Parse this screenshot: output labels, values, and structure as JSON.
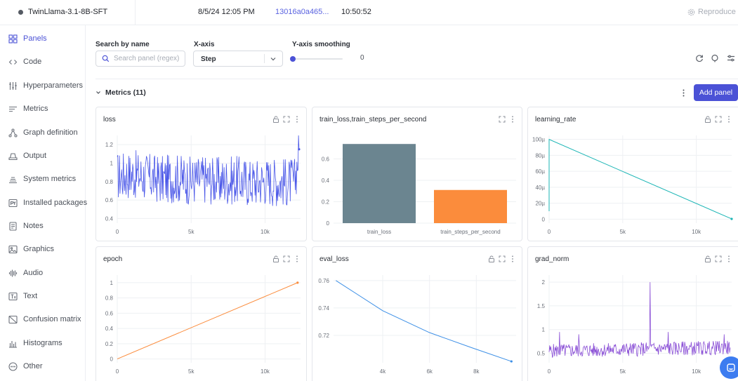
{
  "topbar": {
    "run_name": "TwinLlama-3.1-8B-SFT",
    "date": "8/5/24 12:05 PM",
    "commit": "13016a0a465...",
    "duration": "10:50:52",
    "reproduce": "Reproduce"
  },
  "sidebar": {
    "items": [
      {
        "label": "Panels",
        "icon": "panels-grid-icon"
      },
      {
        "label": "Code",
        "icon": "code-icon"
      },
      {
        "label": "Hyperparameters",
        "icon": "sliders-icon"
      },
      {
        "label": "Metrics",
        "icon": "metrics-lines-icon"
      },
      {
        "label": "Graph definition",
        "icon": "graph-icon"
      },
      {
        "label": "Output",
        "icon": "output-icon"
      },
      {
        "label": "System metrics",
        "icon": "system-metrics-icon"
      },
      {
        "label": "Installed packages",
        "icon": "python-package-icon"
      },
      {
        "label": "Notes",
        "icon": "notes-icon"
      },
      {
        "label": "Graphics",
        "icon": "image-icon"
      },
      {
        "label": "Audio",
        "icon": "audio-wave-icon"
      },
      {
        "label": "Text",
        "icon": "text-icon"
      },
      {
        "label": "Confusion matrix",
        "icon": "matrix-icon"
      },
      {
        "label": "Histograms",
        "icon": "histogram-icon"
      },
      {
        "label": "Other",
        "icon": "more-circle-icon"
      }
    ]
  },
  "controls": {
    "search_label": "Search by name",
    "search_placeholder": "Search panel (regex)",
    "xaxis_label": "X-axis",
    "xaxis_value": "Step",
    "smoothing_label": "Y-axis smoothing",
    "smoothing_value": "0"
  },
  "section": {
    "title": "Metrics (11)",
    "add_panel": "Add panel"
  },
  "colors": {
    "accent": "#4b52d6",
    "loss": "#4a57e8",
    "train_loss_bar": "#6b8590",
    "train_steps_bar": "#fb8c3c",
    "learning_rate": "#1bb5b5",
    "epoch": "#fb8c3c",
    "eval_loss": "#3c8fe6",
    "grad_norm": "#8a4fd6"
  },
  "chart_data": [
    {
      "type": "line",
      "title": "loss",
      "xlim": [
        0,
        12400
      ],
      "ylim": [
        0.35,
        1.3
      ],
      "xticks": [
        0,
        5000,
        10000
      ],
      "xtick_labels": [
        "0",
        "5k",
        "10k"
      ],
      "yticks": [
        0.4,
        0.6,
        0.8,
        1,
        1.2
      ],
      "ytick_labels": [
        "0.4",
        "0.6",
        "0.8",
        "1",
        "1.2"
      ],
      "series": [
        {
          "values_summary": "noisy",
          "x": [
            0,
            1000,
            2000,
            3000,
            4000,
            5000,
            6000,
            7000,
            8000,
            9000,
            10000,
            11000,
            12000,
            12300
          ],
          "y": [
            0.86,
            0.88,
            0.85,
            0.82,
            0.84,
            0.81,
            0.83,
            0.8,
            0.82,
            0.79,
            0.81,
            0.8,
            0.79,
            1.15
          ]
        }
      ],
      "noise_band": [
        0.62,
        1.05
      ]
    },
    {
      "type": "bar",
      "title": "train_loss,train_steps_per_second",
      "categories": [
        "train_loss",
        "train_steps_per_second"
      ],
      "values": [
        0.74,
        0.31
      ],
      "ylim": [
        0,
        0.82
      ],
      "yticks": [
        0,
        0.2,
        0.4,
        0.6
      ],
      "ytick_labels": [
        "0",
        "0.2",
        "0.4",
        "0.6"
      ]
    },
    {
      "type": "line",
      "title": "learning_rate",
      "xlim": [
        0,
        12400
      ],
      "ylim": [
        -5e-06,
        0.000105
      ],
      "xticks": [
        0,
        5000,
        10000
      ],
      "xtick_labels": [
        "0",
        "5k",
        "10k"
      ],
      "yticks": [
        0,
        2e-05,
        4e-05,
        6e-05,
        8e-05,
        0.0001
      ],
      "ytick_labels": [
        "0",
        "20µ",
        "40µ",
        "60µ",
        "80µ",
        "100µ"
      ],
      "series": [
        {
          "x": [
            0,
            0,
            12400
          ],
          "y": [
            1e-05,
            0.0001,
            3e-07
          ]
        }
      ]
    },
    {
      "type": "line",
      "title": "epoch",
      "xlim": [
        0,
        12400
      ],
      "ylim": [
        -0.05,
        1.1
      ],
      "xticks": [
        0,
        5000,
        10000
      ],
      "xtick_labels": [
        "0",
        "5k",
        "10k"
      ],
      "yticks": [
        0,
        0.2,
        0.4,
        0.6,
        0.8,
        1
      ],
      "ytick_labels": [
        "0",
        "0.2",
        "0.4",
        "0.6",
        "0.8",
        "1"
      ],
      "series": [
        {
          "x": [
            0,
            12200
          ],
          "y": [
            0,
            1
          ]
        }
      ]
    },
    {
      "type": "line",
      "title": "eval_loss",
      "xlim": [
        1900,
        9700
      ],
      "ylim": [
        0.7,
        0.764
      ],
      "xticks": [
        4000,
        6000,
        8000
      ],
      "xtick_labels": [
        "4k",
        "6k",
        "8k"
      ],
      "yticks": [
        0.72,
        0.74,
        0.76
      ],
      "ytick_labels": [
        "0.72",
        "0.74",
        "0.76"
      ],
      "series": [
        {
          "x": [
            2000,
            4000,
            6000,
            7800,
            9500
          ],
          "y": [
            0.76,
            0.738,
            0.722,
            0.711,
            0.701
          ]
        }
      ]
    },
    {
      "type": "line",
      "title": "grad_norm",
      "xlim": [
        0,
        12400
      ],
      "ylim": [
        0.3,
        2.15
      ],
      "xticks": [
        0,
        5000,
        10000
      ],
      "xtick_labels": [
        "0",
        "5k",
        "10k"
      ],
      "yticks": [
        0.5,
        1,
        1.5,
        2
      ],
      "ytick_labels": [
        "0.5",
        "1",
        "1.5",
        "2"
      ],
      "series": [
        {
          "x": [
            0,
            12300
          ],
          "y": [
            0.55,
            0.62
          ]
        }
      ],
      "spikes": [
        {
          "x": 700,
          "y": 0.95
        },
        {
          "x": 2000,
          "y": 0.9
        },
        {
          "x": 6850,
          "y": 2.0
        },
        {
          "x": 8100,
          "y": 0.95
        },
        {
          "x": 11900,
          "y": 0.9
        }
      ],
      "noise_band": [
        0.45,
        0.78
      ]
    }
  ]
}
